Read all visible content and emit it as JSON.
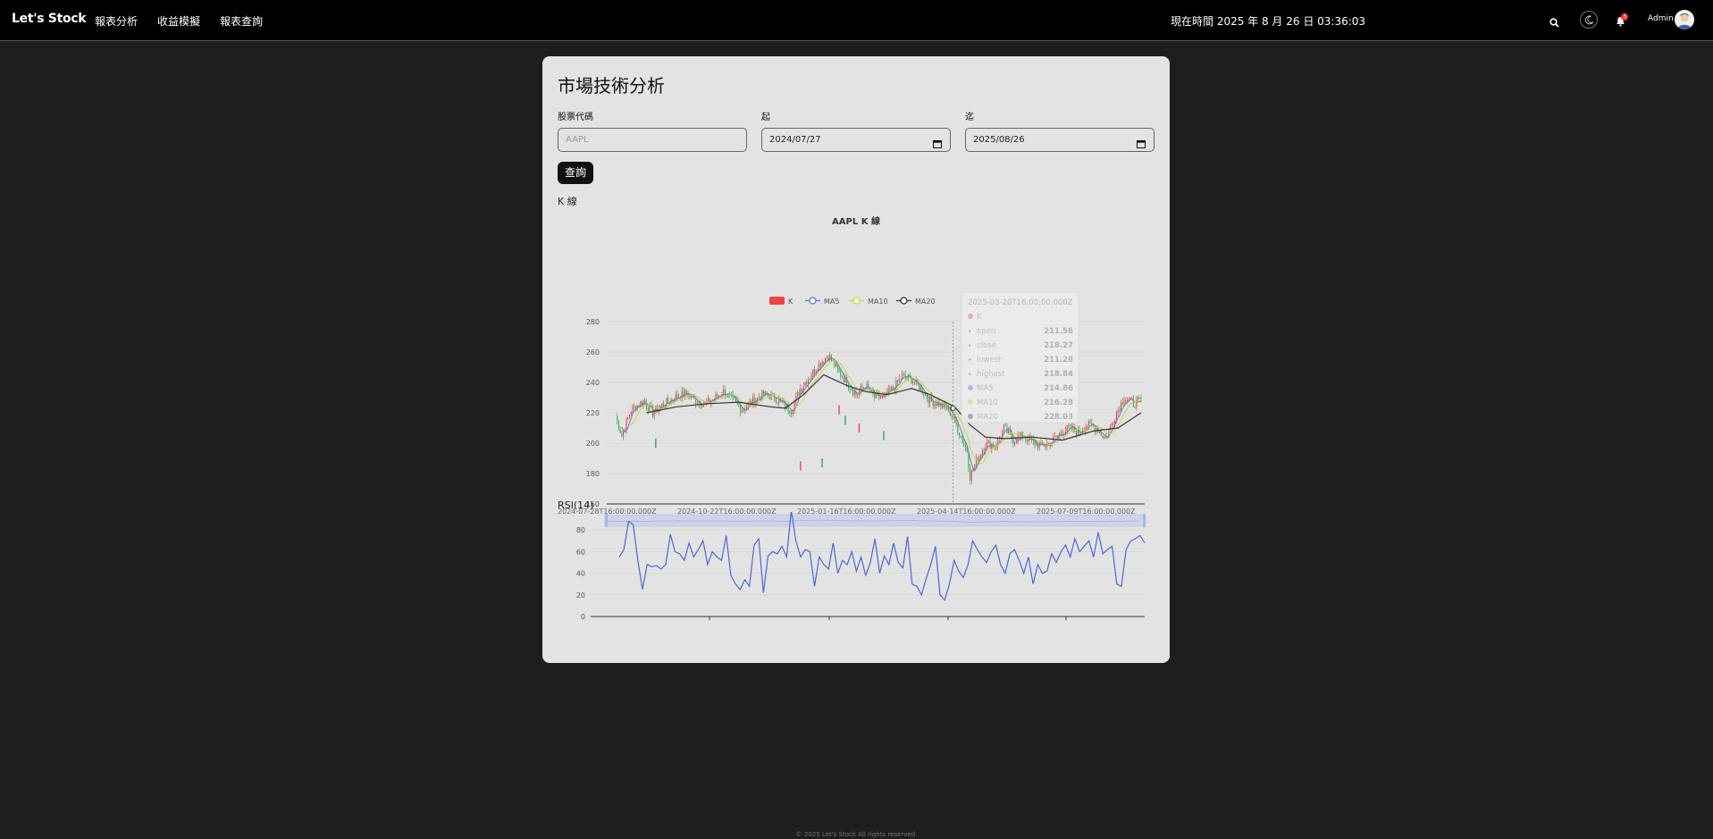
{
  "app": {
    "brand": "Let's Stock"
  },
  "nav": {
    "items": [
      "報表分析",
      "收益模擬",
      "報表查詢"
    ]
  },
  "header": {
    "clock": "現在時間 2025 年 8 月 26 日 03:36:03",
    "user": "Admin",
    "notification_count": "3"
  },
  "page": {
    "title": "市場技術分析",
    "symbol_label": "股票代碼",
    "symbol_placeholder": "AAPL",
    "start_label": "起",
    "start_value": "2024/07/27",
    "end_label": "迄",
    "end_value": "2025/08/26",
    "query_button": "查詢",
    "kline_section": "K 線",
    "rsi_section": "RSI(14)"
  },
  "chart_data": [
    {
      "type": "candlestick",
      "title": "AAPL K 線",
      "legend": [
        "K",
        "MA5",
        "MA10",
        "MA20"
      ],
      "colors": {
        "up": "#ee4444",
        "down": "#33aa44",
        "MA5": "#5b7bd5",
        "MA10": "#c8d63a",
        "MA20": "#333333"
      },
      "ylim": [
        160,
        280
      ],
      "yticks": [
        160,
        180,
        200,
        220,
        240,
        260,
        280
      ],
      "xticks": [
        "2024-07-28T16:00:00.000Z",
        "2024-10-22T16:00:00.000Z",
        "2025-01-16T16:00:00.000Z",
        "2025-04-14T16:00:00.000Z",
        "2025-07-09T16:00:00.000Z"
      ],
      "close_path": [
        [
          0,
          218
        ],
        [
          4,
          205
        ],
        [
          10,
          222
        ],
        [
          18,
          228
        ],
        [
          24,
          220
        ],
        [
          30,
          225
        ],
        [
          38,
          230
        ],
        [
          46,
          233
        ],
        [
          52,
          228
        ],
        [
          58,
          226
        ],
        [
          62,
          228
        ],
        [
          70,
          234
        ],
        [
          76,
          228
        ],
        [
          82,
          222
        ],
        [
          88,
          227
        ],
        [
          96,
          232
        ],
        [
          104,
          230
        ],
        [
          110,
          224
        ],
        [
          114,
          222
        ],
        [
          120,
          236
        ],
        [
          126,
          244
        ],
        [
          132,
          252
        ],
        [
          138,
          258
        ],
        [
          144,
          248
        ],
        [
          150,
          240
        ],
        [
          156,
          232
        ],
        [
          162,
          238
        ],
        [
          168,
          230
        ],
        [
          174,
          230
        ],
        [
          180,
          236
        ],
        [
          186,
          244
        ],
        [
          192,
          242
        ],
        [
          198,
          236
        ],
        [
          204,
          228
        ],
        [
          210,
          226
        ],
        [
          216,
          222
        ],
        [
          220,
          215
        ],
        [
          224,
          204
        ],
        [
          228,
          195
        ],
        [
          230,
          178
        ],
        [
          234,
          188
        ],
        [
          240,
          200
        ],
        [
          246,
          198
        ],
        [
          252,
          210
        ],
        [
          258,
          202
        ],
        [
          264,
          205
        ],
        [
          270,
          201
        ],
        [
          276,
          198
        ],
        [
          282,
          200
        ],
        [
          288,
          206
        ],
        [
          294,
          210
        ],
        [
          300,
          207
        ],
        [
          306,
          212
        ],
        [
          312,
          210
        ],
        [
          318,
          203
        ],
        [
          324,
          218
        ],
        [
          330,
          230
        ],
        [
          336,
          226
        ],
        [
          341,
          228
        ]
      ],
      "ma20_path": [
        [
          20,
          220
        ],
        [
          40,
          224
        ],
        [
          60,
          226
        ],
        [
          80,
          227
        ],
        [
          100,
          224
        ],
        [
          110,
          223
        ],
        [
          122,
          232
        ],
        [
          135,
          245
        ],
        [
          150,
          238
        ],
        [
          162,
          234
        ],
        [
          176,
          232
        ],
        [
          192,
          236
        ],
        [
          204,
          232
        ],
        [
          212,
          228
        ],
        [
          220,
          224
        ],
        [
          230,
          212
        ],
        [
          240,
          204
        ],
        [
          252,
          203
        ],
        [
          270,
          204
        ],
        [
          290,
          202
        ],
        [
          310,
          208
        ],
        [
          326,
          210
        ],
        [
          341,
          220
        ]
      ],
      "outliers": [
        [
          26,
          200
        ],
        [
          120,
          185
        ],
        [
          134,
          187
        ],
        [
          145,
          222
        ],
        [
          149,
          215
        ],
        [
          158,
          210
        ],
        [
          174,
          205
        ]
      ],
      "tooltip": {
        "date": "2025-03-20T16:00:00.000Z",
        "series": "K",
        "rows": [
          {
            "label": "open",
            "value": "211.56"
          },
          {
            "label": "close",
            "value": "218.27"
          },
          {
            "label": "lowest",
            "value": "211.28"
          },
          {
            "label": "highest",
            "value": "218.84"
          },
          {
            "label": "MA5",
            "value": "214.86"
          },
          {
            "label": "MA10",
            "value": "216.28"
          },
          {
            "label": "MA20",
            "value": "228.03"
          }
        ]
      }
    },
    {
      "type": "line",
      "title": "RSI(14)",
      "ylim": [
        0,
        100
      ],
      "yticks": [
        0,
        20,
        40,
        60,
        80,
        100
      ],
      "values": [
        55,
        62,
        88,
        85,
        52,
        25,
        48,
        46,
        47,
        44,
        48,
        76,
        60,
        58,
        52,
        68,
        55,
        62,
        70,
        48,
        60,
        55,
        52,
        75,
        38,
        30,
        25,
        34,
        28,
        66,
        72,
        22,
        56,
        60,
        58,
        65,
        55,
        98,
        70,
        55,
        62,
        60,
        28,
        55,
        48,
        44,
        68,
        40,
        52,
        48,
        60,
        42,
        55,
        38,
        50,
        72,
        40,
        56,
        48,
        68,
        50,
        45,
        74,
        30,
        28,
        20,
        35,
        48,
        65,
        20,
        15,
        30,
        52,
        42,
        36,
        48,
        70,
        62,
        55,
        50,
        60,
        66,
        48,
        40,
        58,
        62,
        52,
        40,
        55,
        30,
        48,
        40,
        42,
        58,
        50,
        60,
        66,
        55,
        72,
        60,
        65,
        70,
        55,
        78,
        58,
        62,
        65,
        30,
        28,
        62,
        70,
        72,
        75,
        68
      ]
    }
  ],
  "footer": {
    "text": "© 2025 Let's Stock All rights reserved."
  }
}
